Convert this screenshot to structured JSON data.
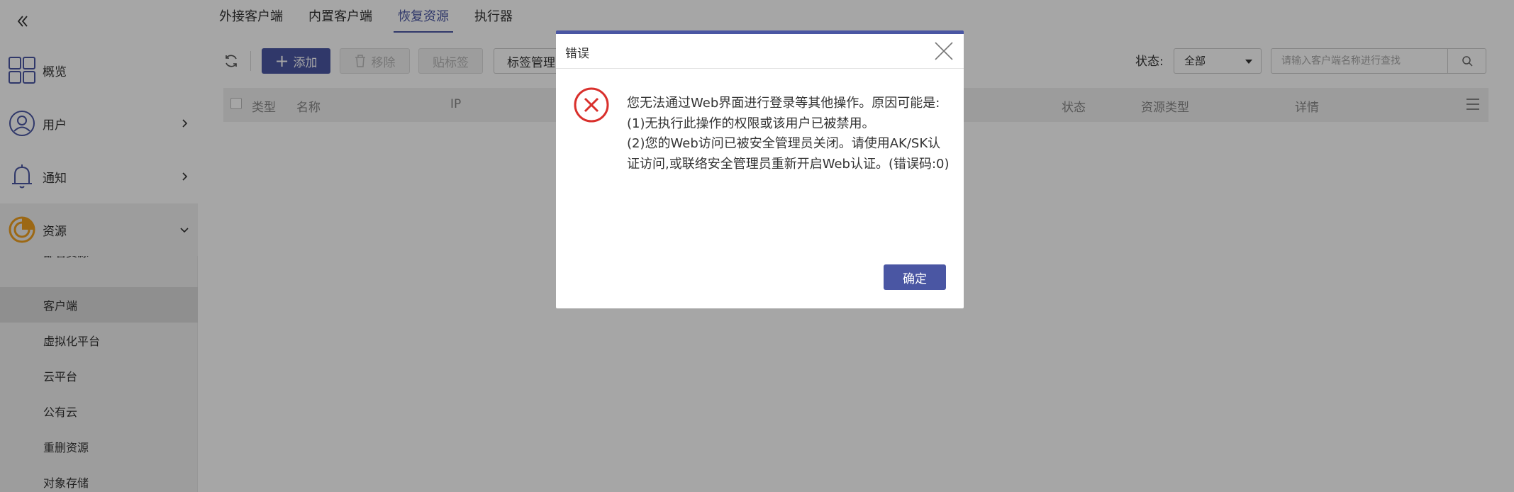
{
  "sidebar": {
    "items": [
      {
        "label": "概览"
      },
      {
        "label": "用户"
      },
      {
        "label": "通知"
      },
      {
        "label": "资源"
      }
    ],
    "sub_items": [
      {
        "label": "部署资源"
      },
      {
        "label": "客户端"
      },
      {
        "label": "虚拟化平台"
      },
      {
        "label": "云平台"
      },
      {
        "label": "公有云"
      },
      {
        "label": "重删资源"
      },
      {
        "label": "对象存储"
      }
    ]
  },
  "tabs": [
    {
      "label": "外接客户端"
    },
    {
      "label": "内置客户端"
    },
    {
      "label": "恢复资源"
    },
    {
      "label": "执行器"
    }
  ],
  "toolbar": {
    "add_label": "添加",
    "remove_label": "移除",
    "tag_label": "贴标签",
    "tag_manage_label": "标签管理",
    "status_label": "状态:",
    "status_value": "全部",
    "search_placeholder": "请输入客户端名称进行查找"
  },
  "table": {
    "columns": {
      "type": "类型",
      "name": "名称",
      "ip": "IP",
      "status": "状态",
      "resource_type": "资源类型",
      "details": "详情"
    }
  },
  "dialog": {
    "title": "错误",
    "message_lines": [
      "您无法通过Web界面进行登录等其他操作。原因可能是:",
      "(1)无执行此操作的权限或该用户已被禁用。",
      "(2)您的Web访问已被安全管理员关闭。请使用AK/SK认证访问,或联络安全管理员重新开启Web认证。(错误码:0)"
    ],
    "ok_label": "确定"
  },
  "colors": {
    "accent": "#4a56a3",
    "error": "#d9302c",
    "orange": "#f0a020"
  }
}
